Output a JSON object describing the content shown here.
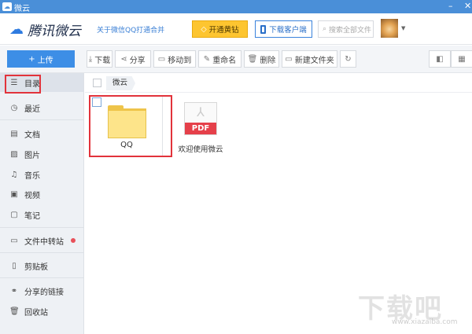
{
  "window": {
    "title": "微云",
    "minimize": "–",
    "close": "✕"
  },
  "header": {
    "logo": "腾讯微云",
    "merge_link": "关于微信QQ打通合并",
    "vip_button": "开通黄钻",
    "download_client": "下载客户端",
    "search_placeholder": "搜索全部文件"
  },
  "toolbar": {
    "upload": "上传",
    "download": "下载",
    "share": "分享",
    "move_to": "移动到",
    "rename": "重命名",
    "delete": "删除",
    "new_folder": "新建文件夹"
  },
  "sidebar": {
    "items": [
      {
        "label": "目录",
        "icon": "list-icon"
      },
      {
        "label": "最近",
        "icon": "clock-icon"
      },
      {
        "label": "文档",
        "icon": "document-icon"
      },
      {
        "label": "图片",
        "icon": "image-icon"
      },
      {
        "label": "音乐",
        "icon": "music-icon"
      },
      {
        "label": "视频",
        "icon": "video-icon"
      },
      {
        "label": "笔记",
        "icon": "note-icon"
      },
      {
        "label": "文件中转站",
        "icon": "transfer-icon"
      },
      {
        "label": "剪贴板",
        "icon": "clipboard-icon"
      },
      {
        "label": "分享的链接",
        "icon": "link-icon"
      },
      {
        "label": "回收站",
        "icon": "trash-icon"
      }
    ]
  },
  "breadcrumb": {
    "root": "微云"
  },
  "files": [
    {
      "name": "QQ",
      "type": "folder"
    },
    {
      "name": "欢迎使用微云",
      "type": "pdf",
      "badge": "PDF"
    }
  ],
  "watermark": {
    "text": "下载吧",
    "url": "www.xiazaiba.com"
  }
}
